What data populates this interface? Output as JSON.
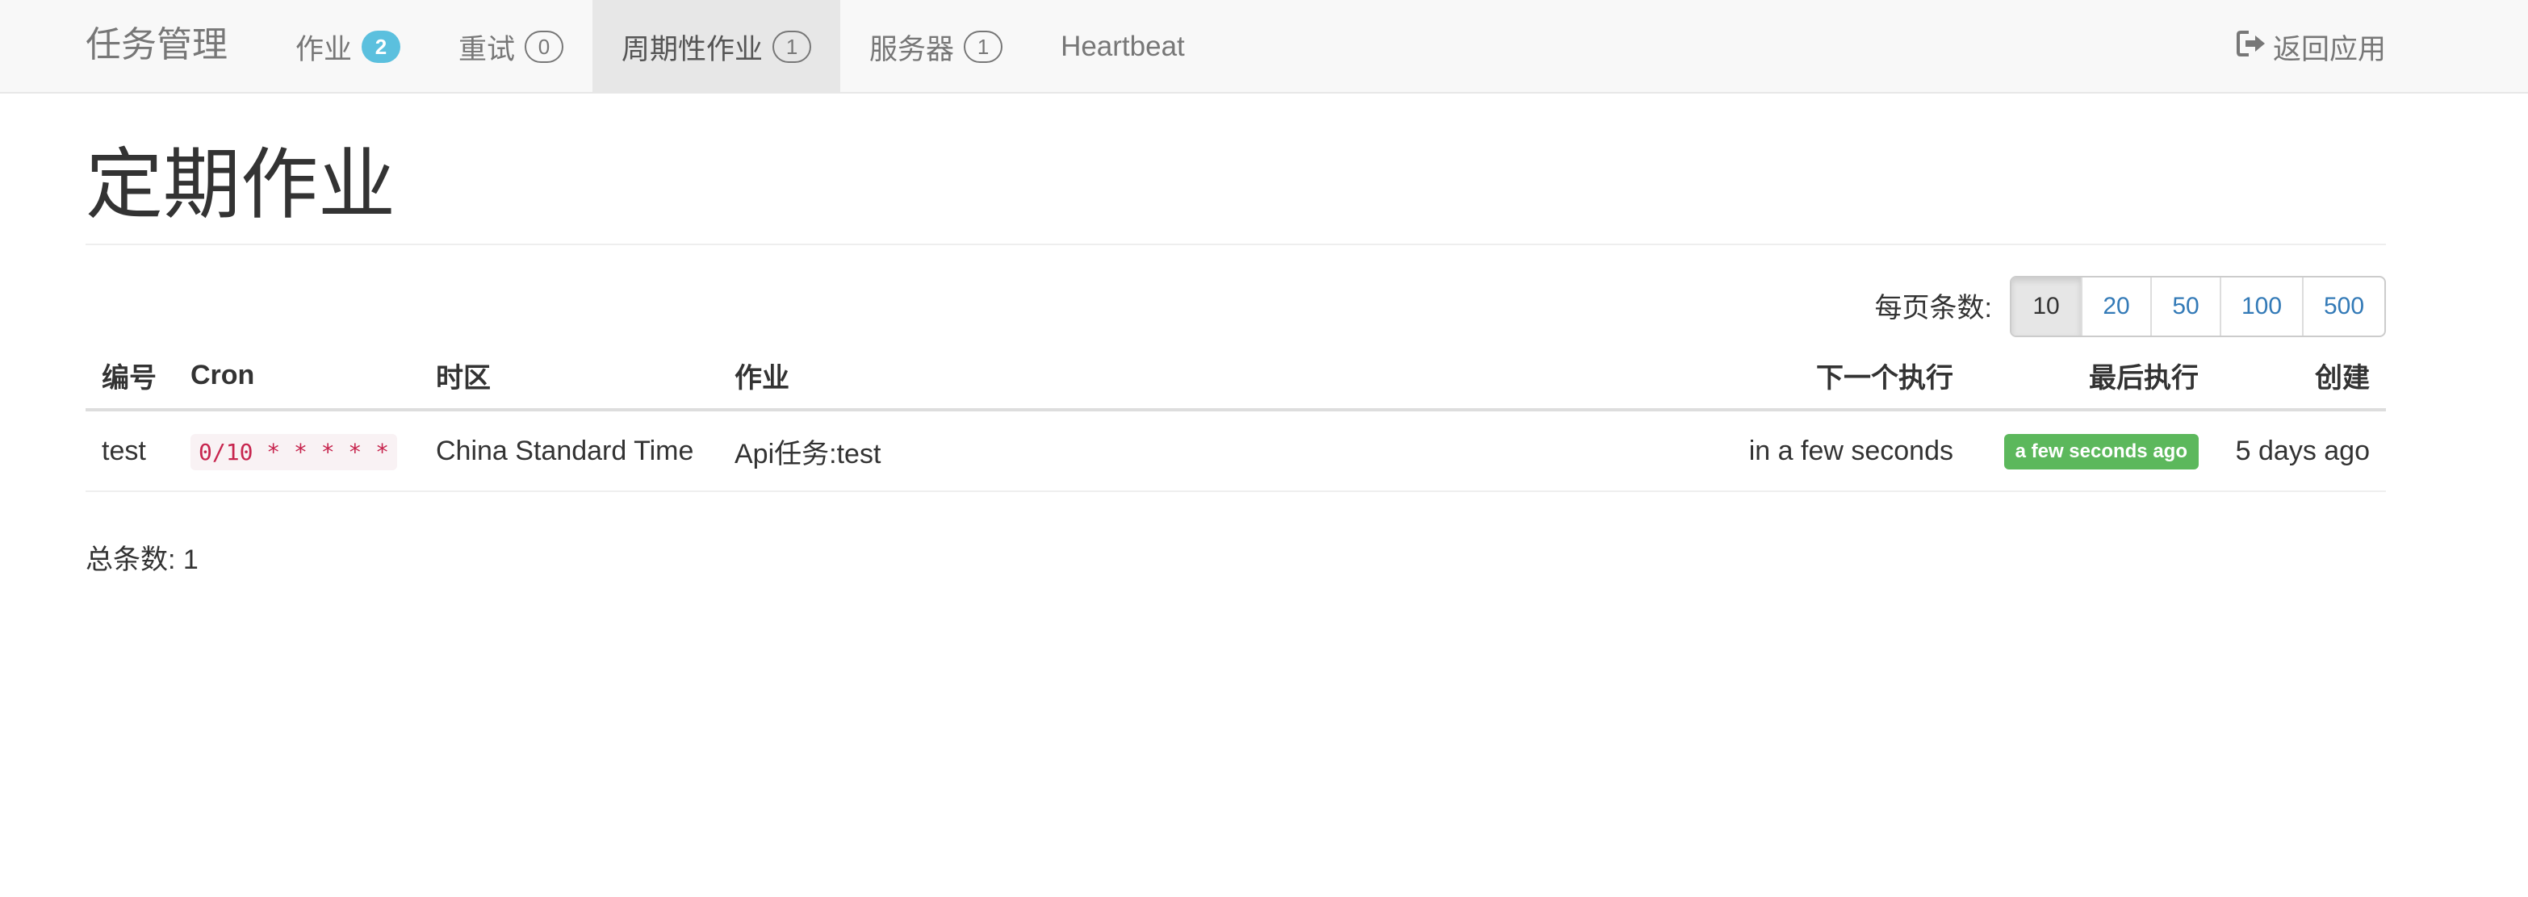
{
  "navbar": {
    "brand": "任务管理",
    "items": [
      {
        "label": "作业",
        "badge": "2"
      },
      {
        "label": "重试",
        "badge": "0"
      },
      {
        "label": "周期性作业",
        "badge": "1"
      },
      {
        "label": "服务器",
        "badge": "1"
      },
      {
        "label": "Heartbeat"
      }
    ],
    "return_label": "返回应用",
    "return_icon": "sign-out-icon"
  },
  "page": {
    "title": "定期作业"
  },
  "pager": {
    "label": "每页条数:",
    "options": [
      "10",
      "20",
      "50",
      "100",
      "500"
    ],
    "selected": "10"
  },
  "table": {
    "headers": [
      "编号",
      "Cron",
      "时区",
      "作业",
      "下一个执行",
      "最后执行",
      "创建"
    ],
    "rows": [
      {
        "id": "test",
        "cron": "0/10 * * * * *",
        "timezone": "China Standard Time",
        "job": "Api任务:test",
        "next_execution": "in a few seconds",
        "last_execution": "a few seconds ago",
        "created": "5 days ago"
      }
    ]
  },
  "footer": {
    "total": "总条数: 1"
  },
  "colors": {
    "accent": "#337ab7",
    "badge_info": "#5bc0de",
    "success": "#5cb85c",
    "code_text": "#c7254e"
  }
}
